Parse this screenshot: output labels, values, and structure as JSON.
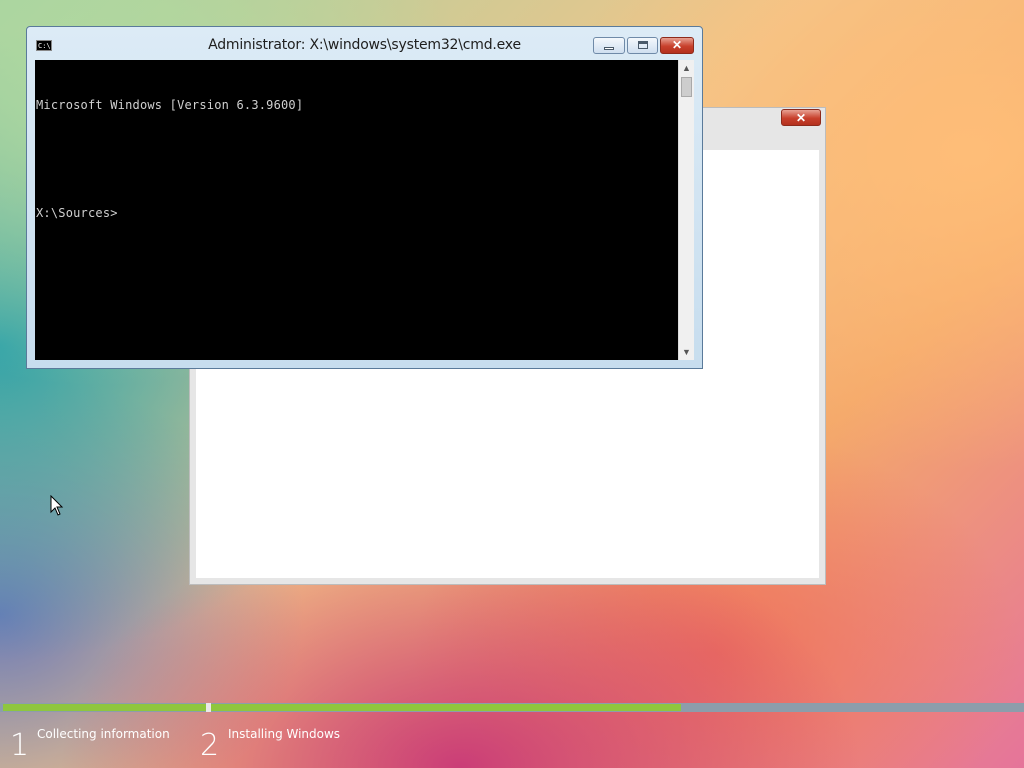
{
  "cmd_window": {
    "title": "Administrator: X:\\windows\\system32\\cmd.exe",
    "icon_label": "C:\\",
    "console_lines": [
      "Microsoft Windows [Version 6.3.9600]",
      "",
      "X:\\Sources>"
    ],
    "buttons": {
      "minimize": "minimize-icon",
      "maximize": "maximize-icon",
      "close": "✕"
    }
  },
  "setup_window": {
    "close": "✕"
  },
  "progress": {
    "steps": [
      {
        "number": "1",
        "label": "Collecting information",
        "progress": 1.0
      },
      {
        "number": "2",
        "label": "Installing Windows",
        "progress": 0.58
      }
    ]
  },
  "colors": {
    "progress_fill": "#8fc63e",
    "progress_track": "#8c9dab",
    "close_button": "#c8402c"
  }
}
